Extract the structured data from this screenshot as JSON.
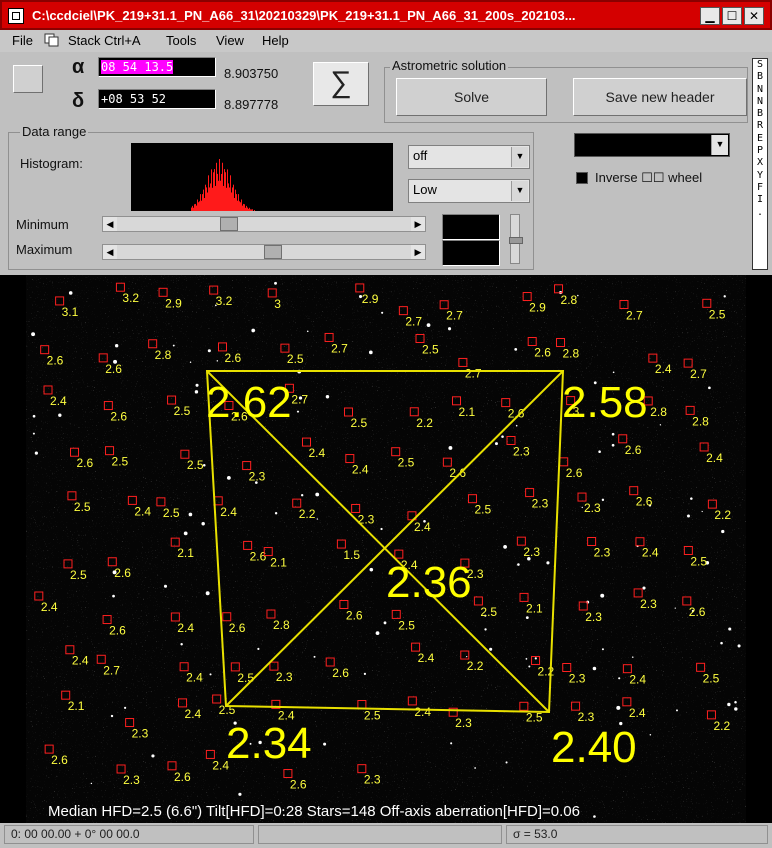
{
  "window": {
    "title": "C:\\ccdciel\\PK_219+31.1_PN_A66_31\\20210329\\PK_219+31.1_PN_A66_31_200s_202103..."
  },
  "menu": {
    "file": "File",
    "stack": "Stack  Ctrl+A",
    "tools": "Tools",
    "view": "View",
    "help": "Help"
  },
  "coords": {
    "alpha_symbol": "α",
    "alpha_value": "08 54 13.5",
    "alpha_decimal": "8.903750",
    "delta_symbol": "δ",
    "delta_value": "+08 53 52",
    "delta_decimal": "8.897778",
    "sigma_symbol": "∑"
  },
  "astrometric": {
    "group_label": "Astrometric solution",
    "solve": "Solve",
    "save_header": "Save new header"
  },
  "data_range": {
    "group_label": "Data range",
    "histogram_label": "Histogram:",
    "stretch_select": "off",
    "level_select": "Low",
    "minimum_label": "Minimum",
    "maximum_label": "Maximum",
    "minimum_position": 0.37,
    "maximum_position": 0.53
  },
  "color": {
    "inverse_label": "Inverse ☐☐ wheel"
  },
  "sidebar_letters": [
    "S",
    "B",
    "N",
    "N",
    "B",
    "R",
    "E",
    "P",
    "X",
    "Y",
    "F",
    "I",
    "."
  ],
  "overlay": {
    "corners": {
      "top_left": "2.62",
      "top_right": "2.58",
      "center": "2.36",
      "bottom_left": "2.34",
      "bottom_right": "2.40"
    },
    "summary": "Median HFD=2.5 (6.6\")  Tilt[HFD]=0.28  Stars=148  Off-axis aberration[HFD]=0.06",
    "star_labels": [
      {
        "t": "3.1"
      },
      {
        "t": "3.2"
      },
      {
        "t": "2.9"
      },
      {
        "t": "3.2"
      },
      {
        "t": "3"
      },
      {
        "t": "2.9"
      },
      {
        "t": "2.7"
      },
      {
        "t": "2.7"
      },
      {
        "t": "2.9"
      },
      {
        "t": "2.8"
      },
      {
        "t": "2.7"
      },
      {
        "t": "2.5"
      },
      {
        "t": "2.6"
      },
      {
        "t": "2.6"
      },
      {
        "t": "2.8"
      },
      {
        "t": "2.6"
      },
      {
        "t": "2.5"
      },
      {
        "t": "2.7"
      },
      {
        "t": "2.5"
      },
      {
        "t": "2.7"
      },
      {
        "t": "2.6"
      },
      {
        "t": "2.8"
      },
      {
        "t": "2.4"
      },
      {
        "t": "2.7"
      },
      {
        "t": "2.4"
      },
      {
        "t": "2.6"
      },
      {
        "t": "2.5"
      },
      {
        "t": "2.6"
      },
      {
        "t": "2.7"
      },
      {
        "t": "2.5"
      },
      {
        "t": "2.2"
      },
      {
        "t": "2.1"
      },
      {
        "t": "2.6"
      },
      {
        "t": "3"
      },
      {
        "t": "2.8"
      },
      {
        "t": "2.8"
      },
      {
        "t": "2.6"
      },
      {
        "t": "2.5"
      },
      {
        "t": "2.5"
      },
      {
        "t": "2.3"
      },
      {
        "t": "2.4"
      },
      {
        "t": "2.4"
      },
      {
        "t": "2.5"
      },
      {
        "t": "2.6"
      },
      {
        "t": "2.3"
      },
      {
        "t": "2.6"
      },
      {
        "t": "2.6"
      },
      {
        "t": "2.4"
      },
      {
        "t": "2.5"
      },
      {
        "t": "2.4"
      },
      {
        "t": "2.5"
      },
      {
        "t": "2.4"
      },
      {
        "t": "2.2"
      },
      {
        "t": "2.3"
      },
      {
        "t": "2.4"
      },
      {
        "t": "2.5"
      },
      {
        "t": "2.3"
      },
      {
        "t": "2.3"
      },
      {
        "t": "2.6"
      },
      {
        "t": "2.2"
      },
      {
        "t": "2.5"
      },
      {
        "t": "2.6"
      },
      {
        "t": "2.1"
      },
      {
        "t": "2.6"
      },
      {
        "t": "2.1"
      },
      {
        "t": "1.5"
      },
      {
        "t": "2.4"
      },
      {
        "t": "2.3"
      },
      {
        "t": "2.3"
      },
      {
        "t": "2.3"
      },
      {
        "t": "2.4"
      },
      {
        "t": "2.5"
      },
      {
        "t": "2.4"
      },
      {
        "t": "2.6"
      },
      {
        "t": "2.4"
      },
      {
        "t": "2.6"
      },
      {
        "t": "2.8"
      },
      {
        "t": "2.6"
      },
      {
        "t": "2.5"
      },
      {
        "t": "2.5"
      },
      {
        "t": "2.1"
      },
      {
        "t": "2.3"
      },
      {
        "t": "2.3"
      },
      {
        "t": "2.6"
      },
      {
        "t": "2.4"
      },
      {
        "t": "2.7"
      },
      {
        "t": "2.4"
      },
      {
        "t": "2.5"
      },
      {
        "t": "2.3"
      },
      {
        "t": "2.6"
      },
      {
        "t": "2.4"
      },
      {
        "t": "2.2"
      },
      {
        "t": "2.2"
      },
      {
        "t": "2.3"
      },
      {
        "t": "2.4"
      },
      {
        "t": "2.5"
      },
      {
        "t": "2.1"
      },
      {
        "t": "2.3"
      },
      {
        "t": "2.4"
      },
      {
        "t": "2.5"
      },
      {
        "t": "2.4"
      },
      {
        "t": "2.5"
      },
      {
        "t": "2.4"
      },
      {
        "t": "2.3"
      },
      {
        "t": "2.5"
      },
      {
        "t": "2.3"
      },
      {
        "t": "2.4"
      },
      {
        "t": "2.2"
      },
      {
        "t": "2.6"
      },
      {
        "t": "2.3"
      },
      {
        "t": "2.6"
      },
      {
        "t": "2.4"
      },
      {
        "t": "2.6"
      },
      {
        "t": "2.3"
      }
    ]
  },
  "status": {
    "coords": "0: 00  00.00  + 0° 00  00.0",
    "sigma": "σ = 53.0"
  }
}
